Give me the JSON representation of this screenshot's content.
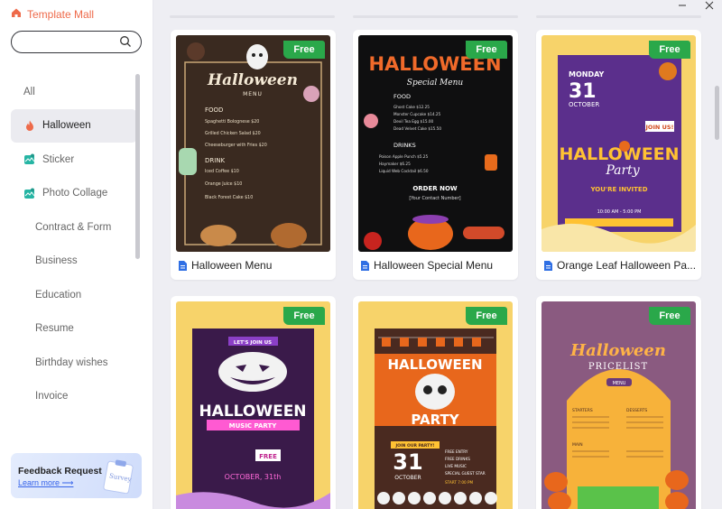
{
  "app": {
    "title": "Template Mall"
  },
  "search": {
    "placeholder": ""
  },
  "sidebar": {
    "items": [
      {
        "label": "All"
      },
      {
        "label": "Halloween"
      },
      {
        "label": "Sticker"
      },
      {
        "label": "Photo Collage"
      },
      {
        "label": "Contract & Form"
      },
      {
        "label": "Business"
      },
      {
        "label": "Education"
      },
      {
        "label": "Resume"
      },
      {
        "label": "Birthday wishes"
      },
      {
        "label": "Invoice"
      }
    ],
    "active": "Halloween"
  },
  "promo": {
    "title": "Feedback Request",
    "link": "Learn more ⟶",
    "art_text": "Survey"
  },
  "badge": {
    "free": "Free"
  },
  "cards": [
    {
      "title": "Halloween Menu",
      "poster": {
        "heading": "Halloween",
        "sub": "MENU",
        "sec1": "FOOD",
        "items1": [
          "Spaghetti Bolognese  $20",
          "Grilled Chicken Salad  $20",
          "Cheeseburger with Fries  $20"
        ],
        "sec2": "DRINK",
        "items2": [
          "Iced Coffee  $10",
          "Orange Juice  $10",
          "Black Forest Cake  $10"
        ]
      }
    },
    {
      "title": "Halloween Special Menu",
      "poster": {
        "heading": "HALLOWEEN",
        "sub": "Special Menu",
        "sec1": "FOOD",
        "items1": [
          "Ghost Cake  $12.25",
          "Monster Cupcake  $14.25",
          "Devil Tea Egg  $15.00",
          "Dead Velvet Cake  $15.50"
        ],
        "sec2": "DRINKS",
        "items2": [
          "Poison Apple Punch  $5.25",
          "Haymaker  $6.25",
          "Liquid Web Cocktail  $6.50"
        ],
        "footer": "ORDER NOW",
        "contact": "[Your Contact Number]"
      }
    },
    {
      "title": "Orange Leaf Halloween Pa...",
      "poster": {
        "day": "MONDAY",
        "date": "31",
        "month": "OCTOBER",
        "join": "JOIN US!",
        "heading": "HALLOWEEN",
        "script": "Party",
        "invite": "YOU'RE INVITED",
        "time": "10:00 AM - 5:00 PM"
      }
    },
    {
      "title": "",
      "poster": {
        "join": "LET'S JOIN US",
        "heading": "HALLOWEEN",
        "sub": "MUSIC PARTY",
        "free": "FREE",
        "date": "OCTOBER, 31th"
      }
    },
    {
      "title": "",
      "poster": {
        "heading": "HALLOWEEN",
        "sub": "PARTY",
        "join": "JOIN OUR PARTY!",
        "date": "31",
        "month": "OCTOBER",
        "list": [
          "FREE ENTRY",
          "FREE DRINKS",
          "LIVE MUSIC",
          "SPECIAL GUEST STAR"
        ],
        "time": "START 7:00 PM"
      }
    },
    {
      "title": "",
      "poster": {
        "heading": "Halloween",
        "sub": "PRICELIST",
        "menu": "MENU",
        "col1": "STARTERS",
        "col2": "DESSERTS",
        "col3": "MAIN"
      }
    }
  ],
  "colors": {
    "accent": "#ee6a4a",
    "free": "#2aa84a",
    "link": "#3563e9"
  }
}
